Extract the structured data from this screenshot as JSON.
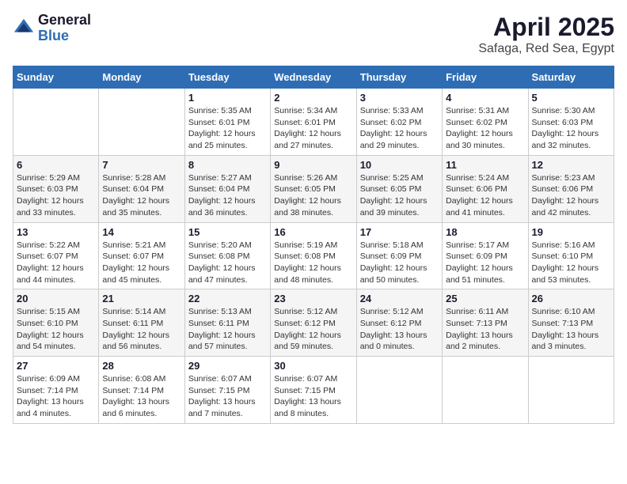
{
  "logo": {
    "general": "General",
    "blue": "Blue"
  },
  "title": "April 2025",
  "subtitle": "Safaga, Red Sea, Egypt",
  "weekdays": [
    "Sunday",
    "Monday",
    "Tuesday",
    "Wednesday",
    "Thursday",
    "Friday",
    "Saturday"
  ],
  "weeks": [
    [
      {
        "day": "",
        "sunrise": "",
        "sunset": "",
        "daylight": ""
      },
      {
        "day": "",
        "sunrise": "",
        "sunset": "",
        "daylight": ""
      },
      {
        "day": "1",
        "sunrise": "Sunrise: 5:35 AM",
        "sunset": "Sunset: 6:01 PM",
        "daylight": "Daylight: 12 hours and 25 minutes."
      },
      {
        "day": "2",
        "sunrise": "Sunrise: 5:34 AM",
        "sunset": "Sunset: 6:01 PM",
        "daylight": "Daylight: 12 hours and 27 minutes."
      },
      {
        "day": "3",
        "sunrise": "Sunrise: 5:33 AM",
        "sunset": "Sunset: 6:02 PM",
        "daylight": "Daylight: 12 hours and 29 minutes."
      },
      {
        "day": "4",
        "sunrise": "Sunrise: 5:31 AM",
        "sunset": "Sunset: 6:02 PM",
        "daylight": "Daylight: 12 hours and 30 minutes."
      },
      {
        "day": "5",
        "sunrise": "Sunrise: 5:30 AM",
        "sunset": "Sunset: 6:03 PM",
        "daylight": "Daylight: 12 hours and 32 minutes."
      }
    ],
    [
      {
        "day": "6",
        "sunrise": "Sunrise: 5:29 AM",
        "sunset": "Sunset: 6:03 PM",
        "daylight": "Daylight: 12 hours and 33 minutes."
      },
      {
        "day": "7",
        "sunrise": "Sunrise: 5:28 AM",
        "sunset": "Sunset: 6:04 PM",
        "daylight": "Daylight: 12 hours and 35 minutes."
      },
      {
        "day": "8",
        "sunrise": "Sunrise: 5:27 AM",
        "sunset": "Sunset: 6:04 PM",
        "daylight": "Daylight: 12 hours and 36 minutes."
      },
      {
        "day": "9",
        "sunrise": "Sunrise: 5:26 AM",
        "sunset": "Sunset: 6:05 PM",
        "daylight": "Daylight: 12 hours and 38 minutes."
      },
      {
        "day": "10",
        "sunrise": "Sunrise: 5:25 AM",
        "sunset": "Sunset: 6:05 PM",
        "daylight": "Daylight: 12 hours and 39 minutes."
      },
      {
        "day": "11",
        "sunrise": "Sunrise: 5:24 AM",
        "sunset": "Sunset: 6:06 PM",
        "daylight": "Daylight: 12 hours and 41 minutes."
      },
      {
        "day": "12",
        "sunrise": "Sunrise: 5:23 AM",
        "sunset": "Sunset: 6:06 PM",
        "daylight": "Daylight: 12 hours and 42 minutes."
      }
    ],
    [
      {
        "day": "13",
        "sunrise": "Sunrise: 5:22 AM",
        "sunset": "Sunset: 6:07 PM",
        "daylight": "Daylight: 12 hours and 44 minutes."
      },
      {
        "day": "14",
        "sunrise": "Sunrise: 5:21 AM",
        "sunset": "Sunset: 6:07 PM",
        "daylight": "Daylight: 12 hours and 45 minutes."
      },
      {
        "day": "15",
        "sunrise": "Sunrise: 5:20 AM",
        "sunset": "Sunset: 6:08 PM",
        "daylight": "Daylight: 12 hours and 47 minutes."
      },
      {
        "day": "16",
        "sunrise": "Sunrise: 5:19 AM",
        "sunset": "Sunset: 6:08 PM",
        "daylight": "Daylight: 12 hours and 48 minutes."
      },
      {
        "day": "17",
        "sunrise": "Sunrise: 5:18 AM",
        "sunset": "Sunset: 6:09 PM",
        "daylight": "Daylight: 12 hours and 50 minutes."
      },
      {
        "day": "18",
        "sunrise": "Sunrise: 5:17 AM",
        "sunset": "Sunset: 6:09 PM",
        "daylight": "Daylight: 12 hours and 51 minutes."
      },
      {
        "day": "19",
        "sunrise": "Sunrise: 5:16 AM",
        "sunset": "Sunset: 6:10 PM",
        "daylight": "Daylight: 12 hours and 53 minutes."
      }
    ],
    [
      {
        "day": "20",
        "sunrise": "Sunrise: 5:15 AM",
        "sunset": "Sunset: 6:10 PM",
        "daylight": "Daylight: 12 hours and 54 minutes."
      },
      {
        "day": "21",
        "sunrise": "Sunrise: 5:14 AM",
        "sunset": "Sunset: 6:11 PM",
        "daylight": "Daylight: 12 hours and 56 minutes."
      },
      {
        "day": "22",
        "sunrise": "Sunrise: 5:13 AM",
        "sunset": "Sunset: 6:11 PM",
        "daylight": "Daylight: 12 hours and 57 minutes."
      },
      {
        "day": "23",
        "sunrise": "Sunrise: 5:12 AM",
        "sunset": "Sunset: 6:12 PM",
        "daylight": "Daylight: 12 hours and 59 minutes."
      },
      {
        "day": "24",
        "sunrise": "Sunrise: 5:12 AM",
        "sunset": "Sunset: 6:12 PM",
        "daylight": "Daylight: 13 hours and 0 minutes."
      },
      {
        "day": "25",
        "sunrise": "Sunrise: 6:11 AM",
        "sunset": "Sunset: 7:13 PM",
        "daylight": "Daylight: 13 hours and 2 minutes."
      },
      {
        "day": "26",
        "sunrise": "Sunrise: 6:10 AM",
        "sunset": "Sunset: 7:13 PM",
        "daylight": "Daylight: 13 hours and 3 minutes."
      }
    ],
    [
      {
        "day": "27",
        "sunrise": "Sunrise: 6:09 AM",
        "sunset": "Sunset: 7:14 PM",
        "daylight": "Daylight: 13 hours and 4 minutes."
      },
      {
        "day": "28",
        "sunrise": "Sunrise: 6:08 AM",
        "sunset": "Sunset: 7:14 PM",
        "daylight": "Daylight: 13 hours and 6 minutes."
      },
      {
        "day": "29",
        "sunrise": "Sunrise: 6:07 AM",
        "sunset": "Sunset: 7:15 PM",
        "daylight": "Daylight: 13 hours and 7 minutes."
      },
      {
        "day": "30",
        "sunrise": "Sunrise: 6:07 AM",
        "sunset": "Sunset: 7:15 PM",
        "daylight": "Daylight: 13 hours and 8 minutes."
      },
      {
        "day": "",
        "sunrise": "",
        "sunset": "",
        "daylight": ""
      },
      {
        "day": "",
        "sunrise": "",
        "sunset": "",
        "daylight": ""
      },
      {
        "day": "",
        "sunrise": "",
        "sunset": "",
        "daylight": ""
      }
    ]
  ]
}
